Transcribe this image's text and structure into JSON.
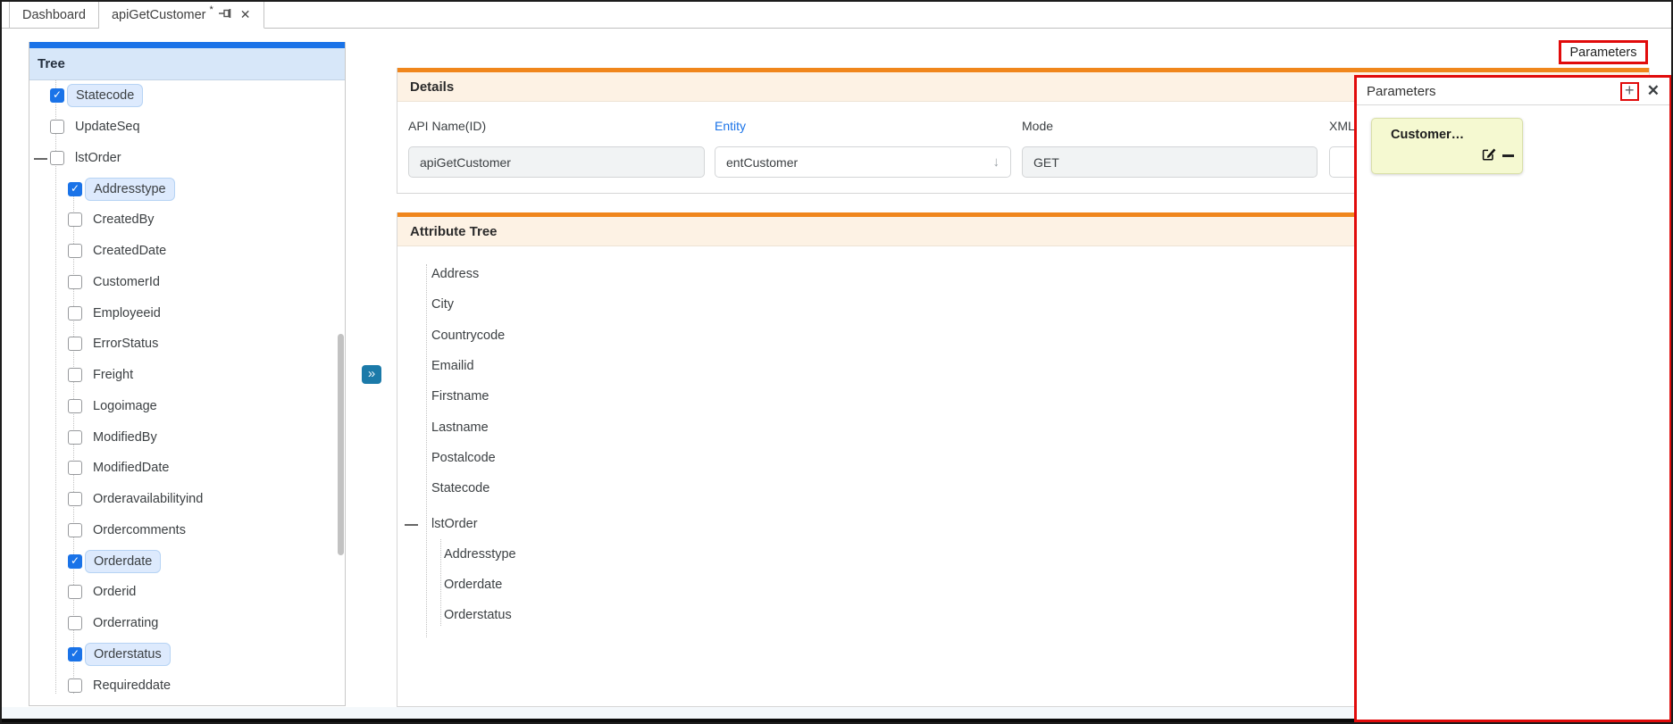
{
  "tabs": [
    {
      "label": "Dashboard",
      "active": false
    },
    {
      "label": "apiGetCustomer",
      "active": true,
      "modified_marker": "*"
    }
  ],
  "tree_panel": {
    "title": "Tree",
    "items": [
      {
        "label": "Statecode",
        "level": 1,
        "checked": true,
        "highlighted": true,
        "expander": false
      },
      {
        "label": "UpdateSeq",
        "level": 1,
        "checked": false,
        "highlighted": false,
        "expander": false
      },
      {
        "label": "lstOrder",
        "level": 1,
        "checked": false,
        "highlighted": false,
        "expander": true
      },
      {
        "label": "Addresstype",
        "level": 2,
        "checked": true,
        "highlighted": true,
        "expander": false
      },
      {
        "label": "CreatedBy",
        "level": 2,
        "checked": false,
        "highlighted": false,
        "expander": false
      },
      {
        "label": "CreatedDate",
        "level": 2,
        "checked": false,
        "highlighted": false,
        "expander": false
      },
      {
        "label": "CustomerId",
        "level": 2,
        "checked": false,
        "highlighted": false,
        "expander": false
      },
      {
        "label": "Employeeid",
        "level": 2,
        "checked": false,
        "highlighted": false,
        "expander": false
      },
      {
        "label": "ErrorStatus",
        "level": 2,
        "checked": false,
        "highlighted": false,
        "expander": false
      },
      {
        "label": "Freight",
        "level": 2,
        "checked": false,
        "highlighted": false,
        "expander": false
      },
      {
        "label": "Logoimage",
        "level": 2,
        "checked": false,
        "highlighted": false,
        "expander": false
      },
      {
        "label": "ModifiedBy",
        "level": 2,
        "checked": false,
        "highlighted": false,
        "expander": false
      },
      {
        "label": "ModifiedDate",
        "level": 2,
        "checked": false,
        "highlighted": false,
        "expander": false
      },
      {
        "label": "Orderavailabilityind",
        "level": 2,
        "checked": false,
        "highlighted": false,
        "expander": false
      },
      {
        "label": "Ordercomments",
        "level": 2,
        "checked": false,
        "highlighted": false,
        "expander": false
      },
      {
        "label": "Orderdate",
        "level": 2,
        "checked": true,
        "highlighted": true,
        "expander": false
      },
      {
        "label": "Orderid",
        "level": 2,
        "checked": false,
        "highlighted": false,
        "expander": false
      },
      {
        "label": "Orderrating",
        "level": 2,
        "checked": false,
        "highlighted": false,
        "expander": false
      },
      {
        "label": "Orderstatus",
        "level": 2,
        "checked": true,
        "highlighted": true,
        "expander": false
      },
      {
        "label": "Requireddate",
        "level": 2,
        "checked": false,
        "highlighted": false,
        "expander": false
      }
    ]
  },
  "details": {
    "title": "Details",
    "fields": [
      {
        "label": "API Name(ID)",
        "value": "apiGetCustomer",
        "style": "readonly"
      },
      {
        "label": "Entity",
        "value": "entCustomer",
        "style": "select"
      },
      {
        "label": "Mode",
        "value": "GET",
        "style": "readonly"
      },
      {
        "label": "XML",
        "value": "",
        "style": "text"
      }
    ]
  },
  "attribute_tree": {
    "title": "Attribute Tree",
    "items": [
      {
        "label": "Address",
        "level": 1,
        "expander": false,
        "gap": false
      },
      {
        "label": "City",
        "level": 1,
        "expander": false,
        "gap": false
      },
      {
        "label": "Countrycode",
        "level": 1,
        "expander": false,
        "gap": false
      },
      {
        "label": "Emailid",
        "level": 1,
        "expander": false,
        "gap": false
      },
      {
        "label": "Firstname",
        "level": 1,
        "expander": false,
        "gap": false
      },
      {
        "label": "Lastname",
        "level": 1,
        "expander": false,
        "gap": false
      },
      {
        "label": "Postalcode",
        "level": 1,
        "expander": false,
        "gap": false
      },
      {
        "label": "Statecode",
        "level": 1,
        "expander": false,
        "gap": false
      },
      {
        "label": "lstOrder",
        "level": 1,
        "expander": true,
        "gap": true
      },
      {
        "label": "Addresstype",
        "level": 2,
        "expander": false,
        "gap": false
      },
      {
        "label": "Orderdate",
        "level": 2,
        "expander": false,
        "gap": false
      },
      {
        "label": "Orderstatus",
        "level": 2,
        "expander": false,
        "gap": false
      }
    ]
  },
  "parameters_button": {
    "label": "Parameters"
  },
  "parameters_panel": {
    "title": "Parameters",
    "note": {
      "label": "Customer…"
    }
  },
  "glyphs": {
    "check": "✓",
    "expand_right": "»",
    "dropdown_arrow": "↓",
    "tab_close": "✕",
    "panel_close": "✕",
    "add": "+"
  },
  "colors": {
    "accent_blue": "#1a73e8",
    "panel_orange": "#f0861c",
    "highlight_red": "#e10b0b",
    "note_yellow": "#f5f9d1",
    "tree_header_blue": "#d7e7f9"
  }
}
